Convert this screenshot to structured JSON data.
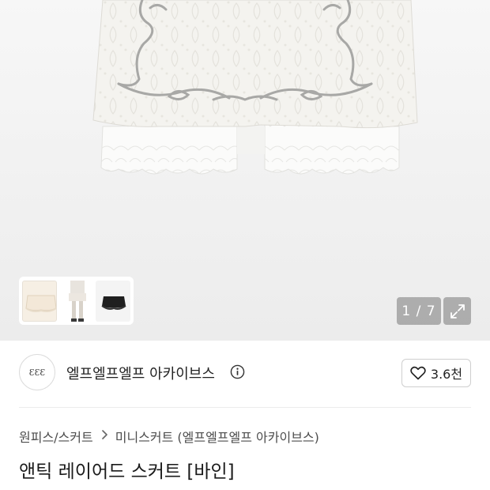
{
  "gallery": {
    "counter": "1 / 7",
    "expand_icon": "expand-icon"
  },
  "thumbnails": [
    {
      "name": "thumbnail-cream-skirt"
    },
    {
      "name": "thumbnail-model"
    },
    {
      "name": "thumbnail-black-skirt"
    }
  ],
  "shop": {
    "name": "엘프엘프엘프 아카이브스",
    "logo_text": "ƐƐƐ",
    "info_icon": "info-icon",
    "likes": "3.6천",
    "like_icon": "heart-icon"
  },
  "breadcrumb": {
    "category": "원피스/스커트",
    "separator_icon": "chevron-right-icon",
    "subcategory": "미니스커트 (엘프엘프엘프 아카이브스)"
  },
  "product": {
    "title": "앤틱 레이어드 스커트 [바인]"
  },
  "colors": {
    "hero_bg": "#efefef",
    "overlay": "#8a8a8a"
  }
}
